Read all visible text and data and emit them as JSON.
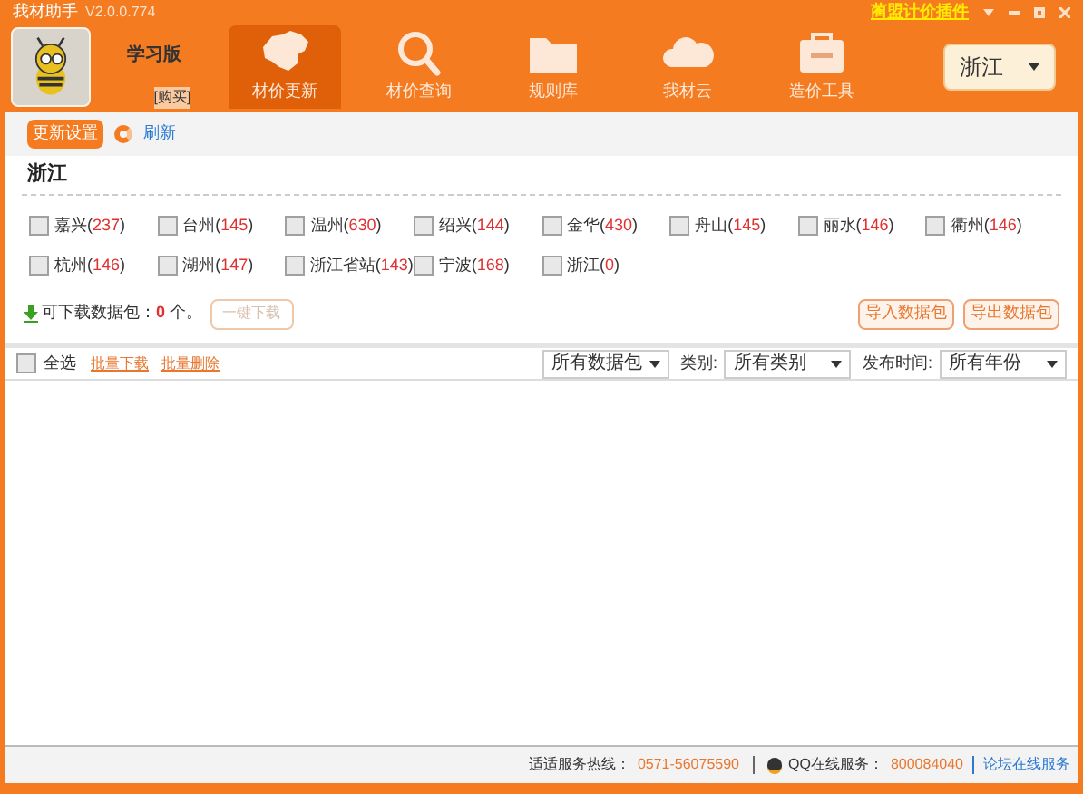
{
  "window": {
    "title": "我材助手",
    "version": "V2.0.0.774",
    "plugin_link": "蔺盟计价插件"
  },
  "header": {
    "edition": "学习版",
    "buy": "[购买]",
    "region": "浙江"
  },
  "nav": [
    {
      "label": "材价更新",
      "kind": "map",
      "selected": true
    },
    {
      "label": "材价查询",
      "kind": "search",
      "selected": false
    },
    {
      "label": "规则库",
      "kind": "folder",
      "selected": false
    },
    {
      "label": "我材云",
      "kind": "cloud",
      "selected": false
    },
    {
      "label": "造价工具",
      "kind": "toolbox",
      "selected": false
    }
  ],
  "toolbar": {
    "settings": "更新设置",
    "refresh": "刷新"
  },
  "region_title": "浙江",
  "cities": [
    {
      "name": "嘉兴",
      "open": "(",
      "count": "237",
      "close": ")",
      "checked": false
    },
    {
      "name": "台州",
      "open": "(",
      "count": "145",
      "close": ")",
      "checked": false
    },
    {
      "name": "温州",
      "open": "(",
      "count": "630",
      "close": ")",
      "checked": false
    },
    {
      "name": "绍兴",
      "open": "(",
      "count": "144",
      "close": ")",
      "checked": false
    },
    {
      "name": "金华",
      "open": "(",
      "count": "430",
      "close": ")",
      "checked": false
    },
    {
      "name": "舟山",
      "open": "(",
      "count": "145",
      "close": ")",
      "checked": false
    },
    {
      "name": "丽水",
      "open": "(",
      "count": "146",
      "close": ")",
      "checked": false
    },
    {
      "name": "衢州",
      "open": "(",
      "count": "146",
      "close": ")",
      "checked": false
    },
    {
      "name": "杭州",
      "open": "(",
      "count": "146",
      "close": ")",
      "checked": false
    },
    {
      "name": "湖州",
      "open": "(",
      "count": "147",
      "close": ")",
      "checked": false
    },
    {
      "name": "浙江省站",
      "open": "(",
      "count": "143",
      "close": ")",
      "checked": false
    },
    {
      "name": "宁波",
      "open": "(",
      "count": "168",
      "close": ")",
      "checked": false
    },
    {
      "name": "浙江",
      "open": "(",
      "count": "0",
      "close": ")",
      "checked": false
    }
  ],
  "download": {
    "label": "可下载数据包：",
    "count": "0",
    "unit": "个。",
    "button": "一键下载",
    "import": "导入数据包",
    "export": "导出数据包"
  },
  "filters": {
    "select_all": "全选",
    "select_all_checked": false,
    "batch_download": "批量下载",
    "batch_delete": "批量删除",
    "package": "所有数据包",
    "category_label": "类别:",
    "category": "所有类别",
    "time_label": "发布时间:",
    "time": "所有年份"
  },
  "status_bar": {
    "hotline_label": "适适服务热线：",
    "hotline": "0571-56075590",
    "qq_label": "QQ在线服务：",
    "qq": "800084040",
    "forum": "论坛在线服务"
  }
}
